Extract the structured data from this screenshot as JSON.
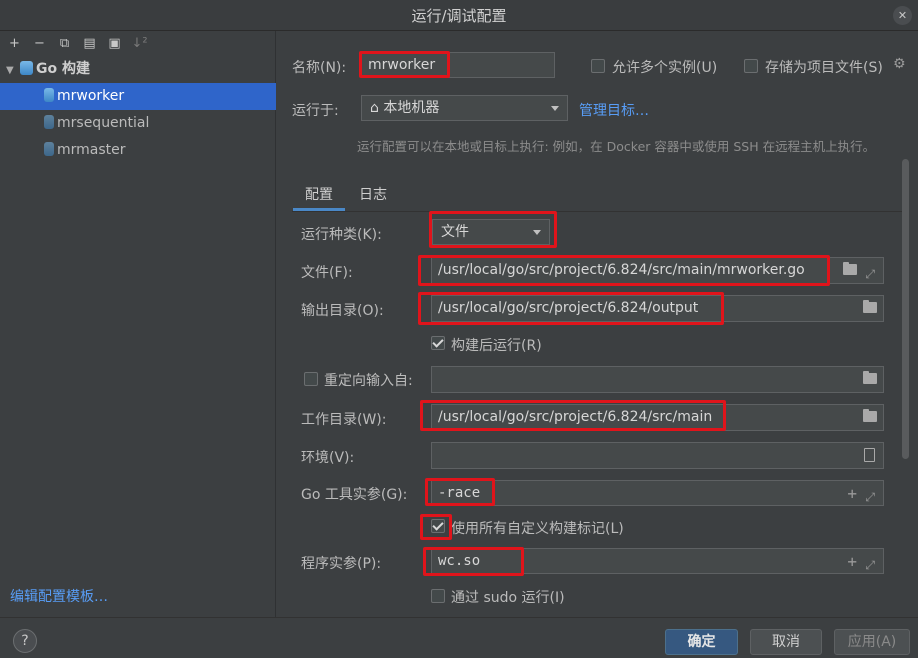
{
  "window": {
    "title": "运行/调试配置"
  },
  "toolbar": {
    "add": "+",
    "remove": "−",
    "copy": "⧉",
    "save": "▤",
    "folder": "▣",
    "sort": "↓²"
  },
  "tree": {
    "group": "Go 构建",
    "items": [
      "mrworker",
      "mrsequential",
      "mrmaster"
    ]
  },
  "edit_templates": "编辑配置模板…",
  "form": {
    "name_label": "名称(N):",
    "name_value": "mrworker",
    "allow_multiple": "允许多个实例(U)",
    "store_as_file": "存储为项目文件(S)",
    "run_on_label": "运行于:",
    "run_on_value": "本地机器",
    "manage_targets": "管理目标…",
    "hint": "运行配置可以在本地或目标上执行: 例如，在 Docker 容器中或使用 SSH 在远程主机上执行。",
    "tabs": [
      "配置",
      "日志"
    ],
    "kind_label": "运行种类(K):",
    "kind_value": "文件",
    "file_label": "文件(F):",
    "file_value": "/usr/local/go/src/project/6.824/src/main/mrworker.go",
    "output_label": "输出目录(O):",
    "output_value": "/usr/local/go/src/project/6.824/output",
    "run_after_build": "构建后运行(R)",
    "redirect_input": "重定向输入自:",
    "workdir_label": "工作目录(W):",
    "workdir_value": "/usr/local/go/src/project/6.824/src/main",
    "env_label": "环境(V):",
    "go_tool_args_label": "Go 工具实参(G):",
    "go_tool_args_value": "-race",
    "use_custom_tags": "使用所有自定义构建标记(L)",
    "program_args_label": "程序实参(P):",
    "program_args_value": "wc.so",
    "run_with_sudo": "通过 sudo 运行(I)"
  },
  "buttons": {
    "help": "?",
    "ok": "确定",
    "cancel": "取消",
    "apply": "应用(A)"
  }
}
